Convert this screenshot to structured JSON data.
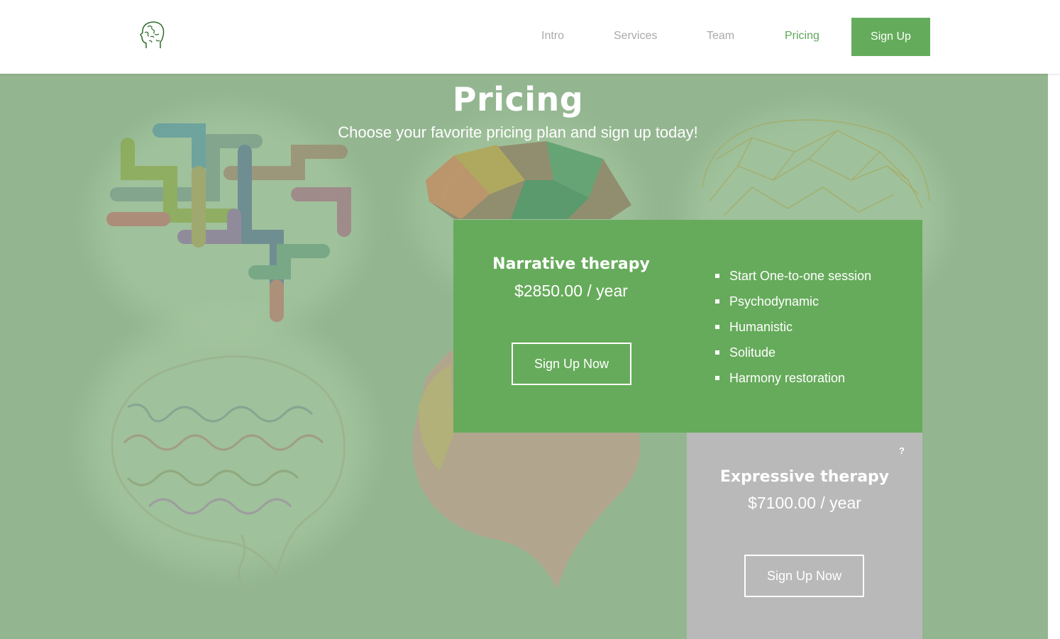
{
  "nav": {
    "links": [
      "Intro",
      "Services",
      "Team",
      "Pricing"
    ],
    "active": "Pricing",
    "signup_label": "Sign Up"
  },
  "logo": {
    "icon": "puzzle-head-icon"
  },
  "hero": {
    "title": "Pricing",
    "subtitle": "Choose your favorite pricing plan and sign up today!"
  },
  "plans": [
    {
      "name": "Narrative therapy",
      "price": "$2850.00 / year",
      "button_label": "Sign Up Now",
      "features": [
        "Start One-to-one session",
        "Psychodynamic",
        "Humanistic",
        "Solitude",
        "Harmony restoration"
      ]
    },
    {
      "name": "Expressive therapy",
      "price": "$7100.00 / year",
      "button_label": "Sign Up Now",
      "badge": "?"
    }
  ],
  "colors": {
    "accent": "#64ac5b",
    "hero_overlay": "#93b690",
    "card_primary": "#66ab5b",
    "card_secondary": "#b9b9b9",
    "nav_inactive": "#a9a9a9"
  }
}
